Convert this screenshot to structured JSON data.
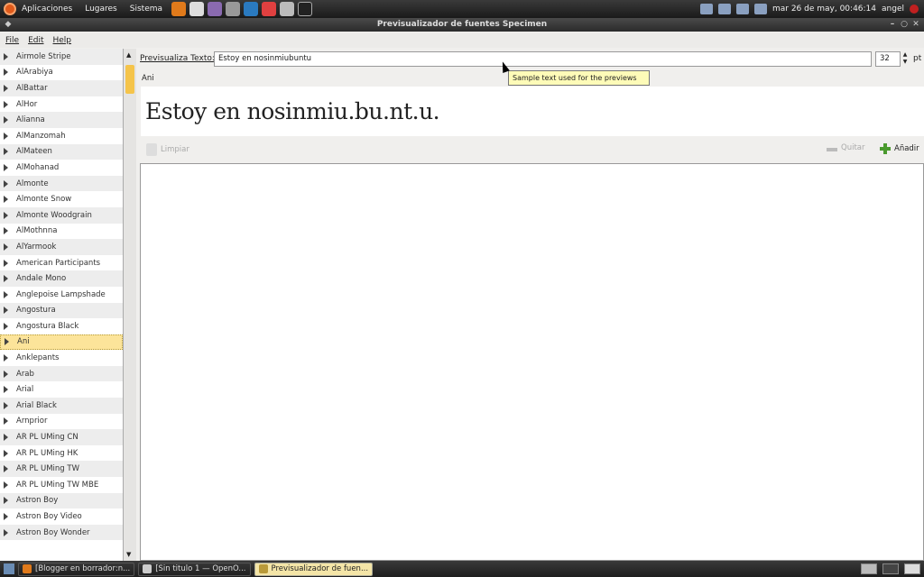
{
  "top_panel": {
    "menus": [
      "Aplicaciones",
      "Lugares",
      "Sistema"
    ],
    "clock": "mar 26 de may, 00:46:14",
    "user": "angel"
  },
  "window": {
    "title": "Previsualizador de fuentes Specimen"
  },
  "menubar": [
    "File",
    "Edit",
    "Help"
  ],
  "fonts": [
    "Airmole Stripe",
    "AlArabiya",
    "AlBattar",
    "AlHor",
    "Alianna",
    "AlManzomah",
    "AlMateen",
    "AlMohanad",
    "Almonte",
    "Almonte Snow",
    "Almonte Woodgrain",
    "AlMothnna",
    "AlYarmook",
    "American Participants",
    "Andale Mono",
    "Anglepoise Lampshade",
    "Angostura",
    "Angostura Black",
    "Ani",
    "Anklepants",
    "Arab",
    "Arial",
    "Arial Black",
    "Arnprior",
    "AR PL UMing CN",
    "AR PL UMing HK",
    "AR PL UMing TW",
    "AR PL UMing TW MBE",
    "Astron Boy",
    "Astron Boy Video",
    "Astron Boy Wonder"
  ],
  "selected_font": "Ani",
  "preview_label": "Previsualiza Texto:",
  "preview_text": "Estoy en nosinmiubuntu",
  "size": "32",
  "size_unit": "pt",
  "current_font_name": "Ani",
  "preview_rendered": "Estoy en nosinmiu.bu.nt.u.",
  "tooltip": "Sample text used for the previews",
  "toolbar": {
    "clear": "Limpiar",
    "remove": "Quitar",
    "add": "Añadir"
  },
  "taskbar": [
    {
      "label": "[Blogger en borrador:n...",
      "active": false
    },
    {
      "label": "[Sin titulo 1 — OpenO...",
      "active": false
    },
    {
      "label": "Previsualizador de fuen...",
      "active": true
    }
  ]
}
